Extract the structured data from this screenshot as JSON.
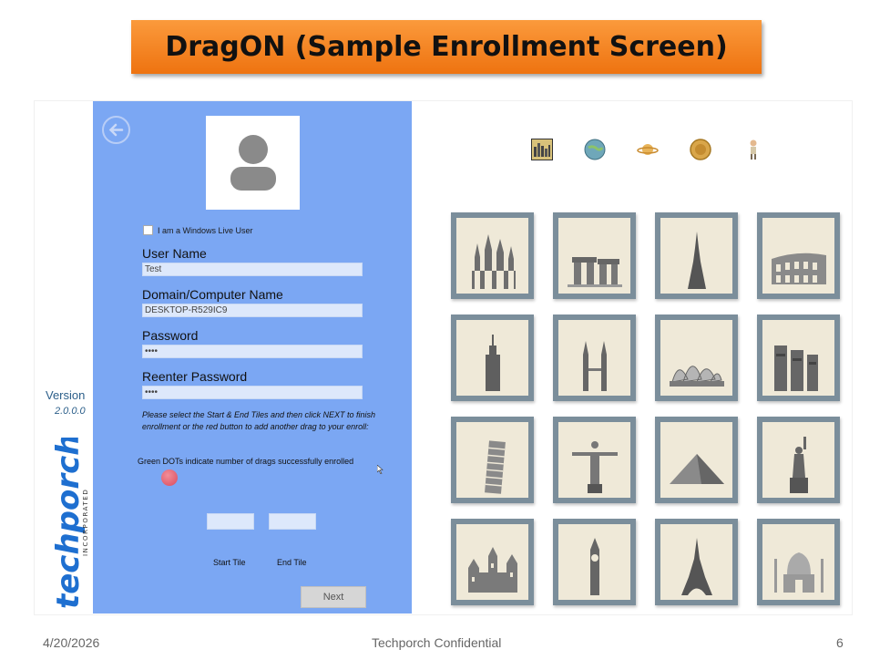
{
  "slide": {
    "title": "DragON (Sample Enrollment Screen)",
    "footer_date": "4/20/2026",
    "footer_center": "Techporch Confidential",
    "footer_page": "6"
  },
  "sidebar": {
    "version_label": "Version",
    "version_number": "2.0.0.0",
    "logo_text": "techporch",
    "logo_sub": "INCORPORATED"
  },
  "form": {
    "windows_live_label": "I am a Windows Live User",
    "windows_live_checked": false,
    "username_label": "User Name",
    "username_value": "Test",
    "domain_label": "Domain/Computer Name",
    "domain_value": "DESKTOP-R529IC9",
    "password_label": "Password",
    "password_value": "••••",
    "reenter_label": "Reenter Password",
    "reenter_value": "••••",
    "instructions": "Please select the Start & End Tiles and then click NEXT to finish enrollment or the red button to add another drag to your enroll:",
    "green_dots_note": "Green DOTs indicate number of drags successfully enrolled",
    "start_tile_label": "Start Tile",
    "end_tile_label": "End Tile",
    "next_label": "Next"
  },
  "categories": [
    {
      "icon": "cityscape-icon"
    },
    {
      "icon": "globe-icon"
    },
    {
      "icon": "planet-icon"
    },
    {
      "icon": "coin-icon"
    },
    {
      "icon": "figure-icon"
    }
  ],
  "tiles": [
    {
      "icon": "sagrada-familia-icon"
    },
    {
      "icon": "stonehenge-icon"
    },
    {
      "icon": "burj-khalifa-icon"
    },
    {
      "icon": "colosseum-icon"
    },
    {
      "icon": "empire-state-icon"
    },
    {
      "icon": "petronas-towers-icon"
    },
    {
      "icon": "sydney-opera-icon"
    },
    {
      "icon": "moai-icon"
    },
    {
      "icon": "leaning-tower-icon"
    },
    {
      "icon": "christ-redeemer-icon"
    },
    {
      "icon": "pyramid-icon"
    },
    {
      "icon": "statue-of-liberty-icon"
    },
    {
      "icon": "castle-icon"
    },
    {
      "icon": "big-ben-icon"
    },
    {
      "icon": "eiffel-tower-icon"
    },
    {
      "icon": "taj-mahal-icon"
    }
  ],
  "colors": {
    "banner": "#f08020",
    "panel": "#7ba7f3",
    "tile_frame": "#7b8e9b",
    "tile_bg": "#efe9d8",
    "red_button": "#d94a5c"
  }
}
